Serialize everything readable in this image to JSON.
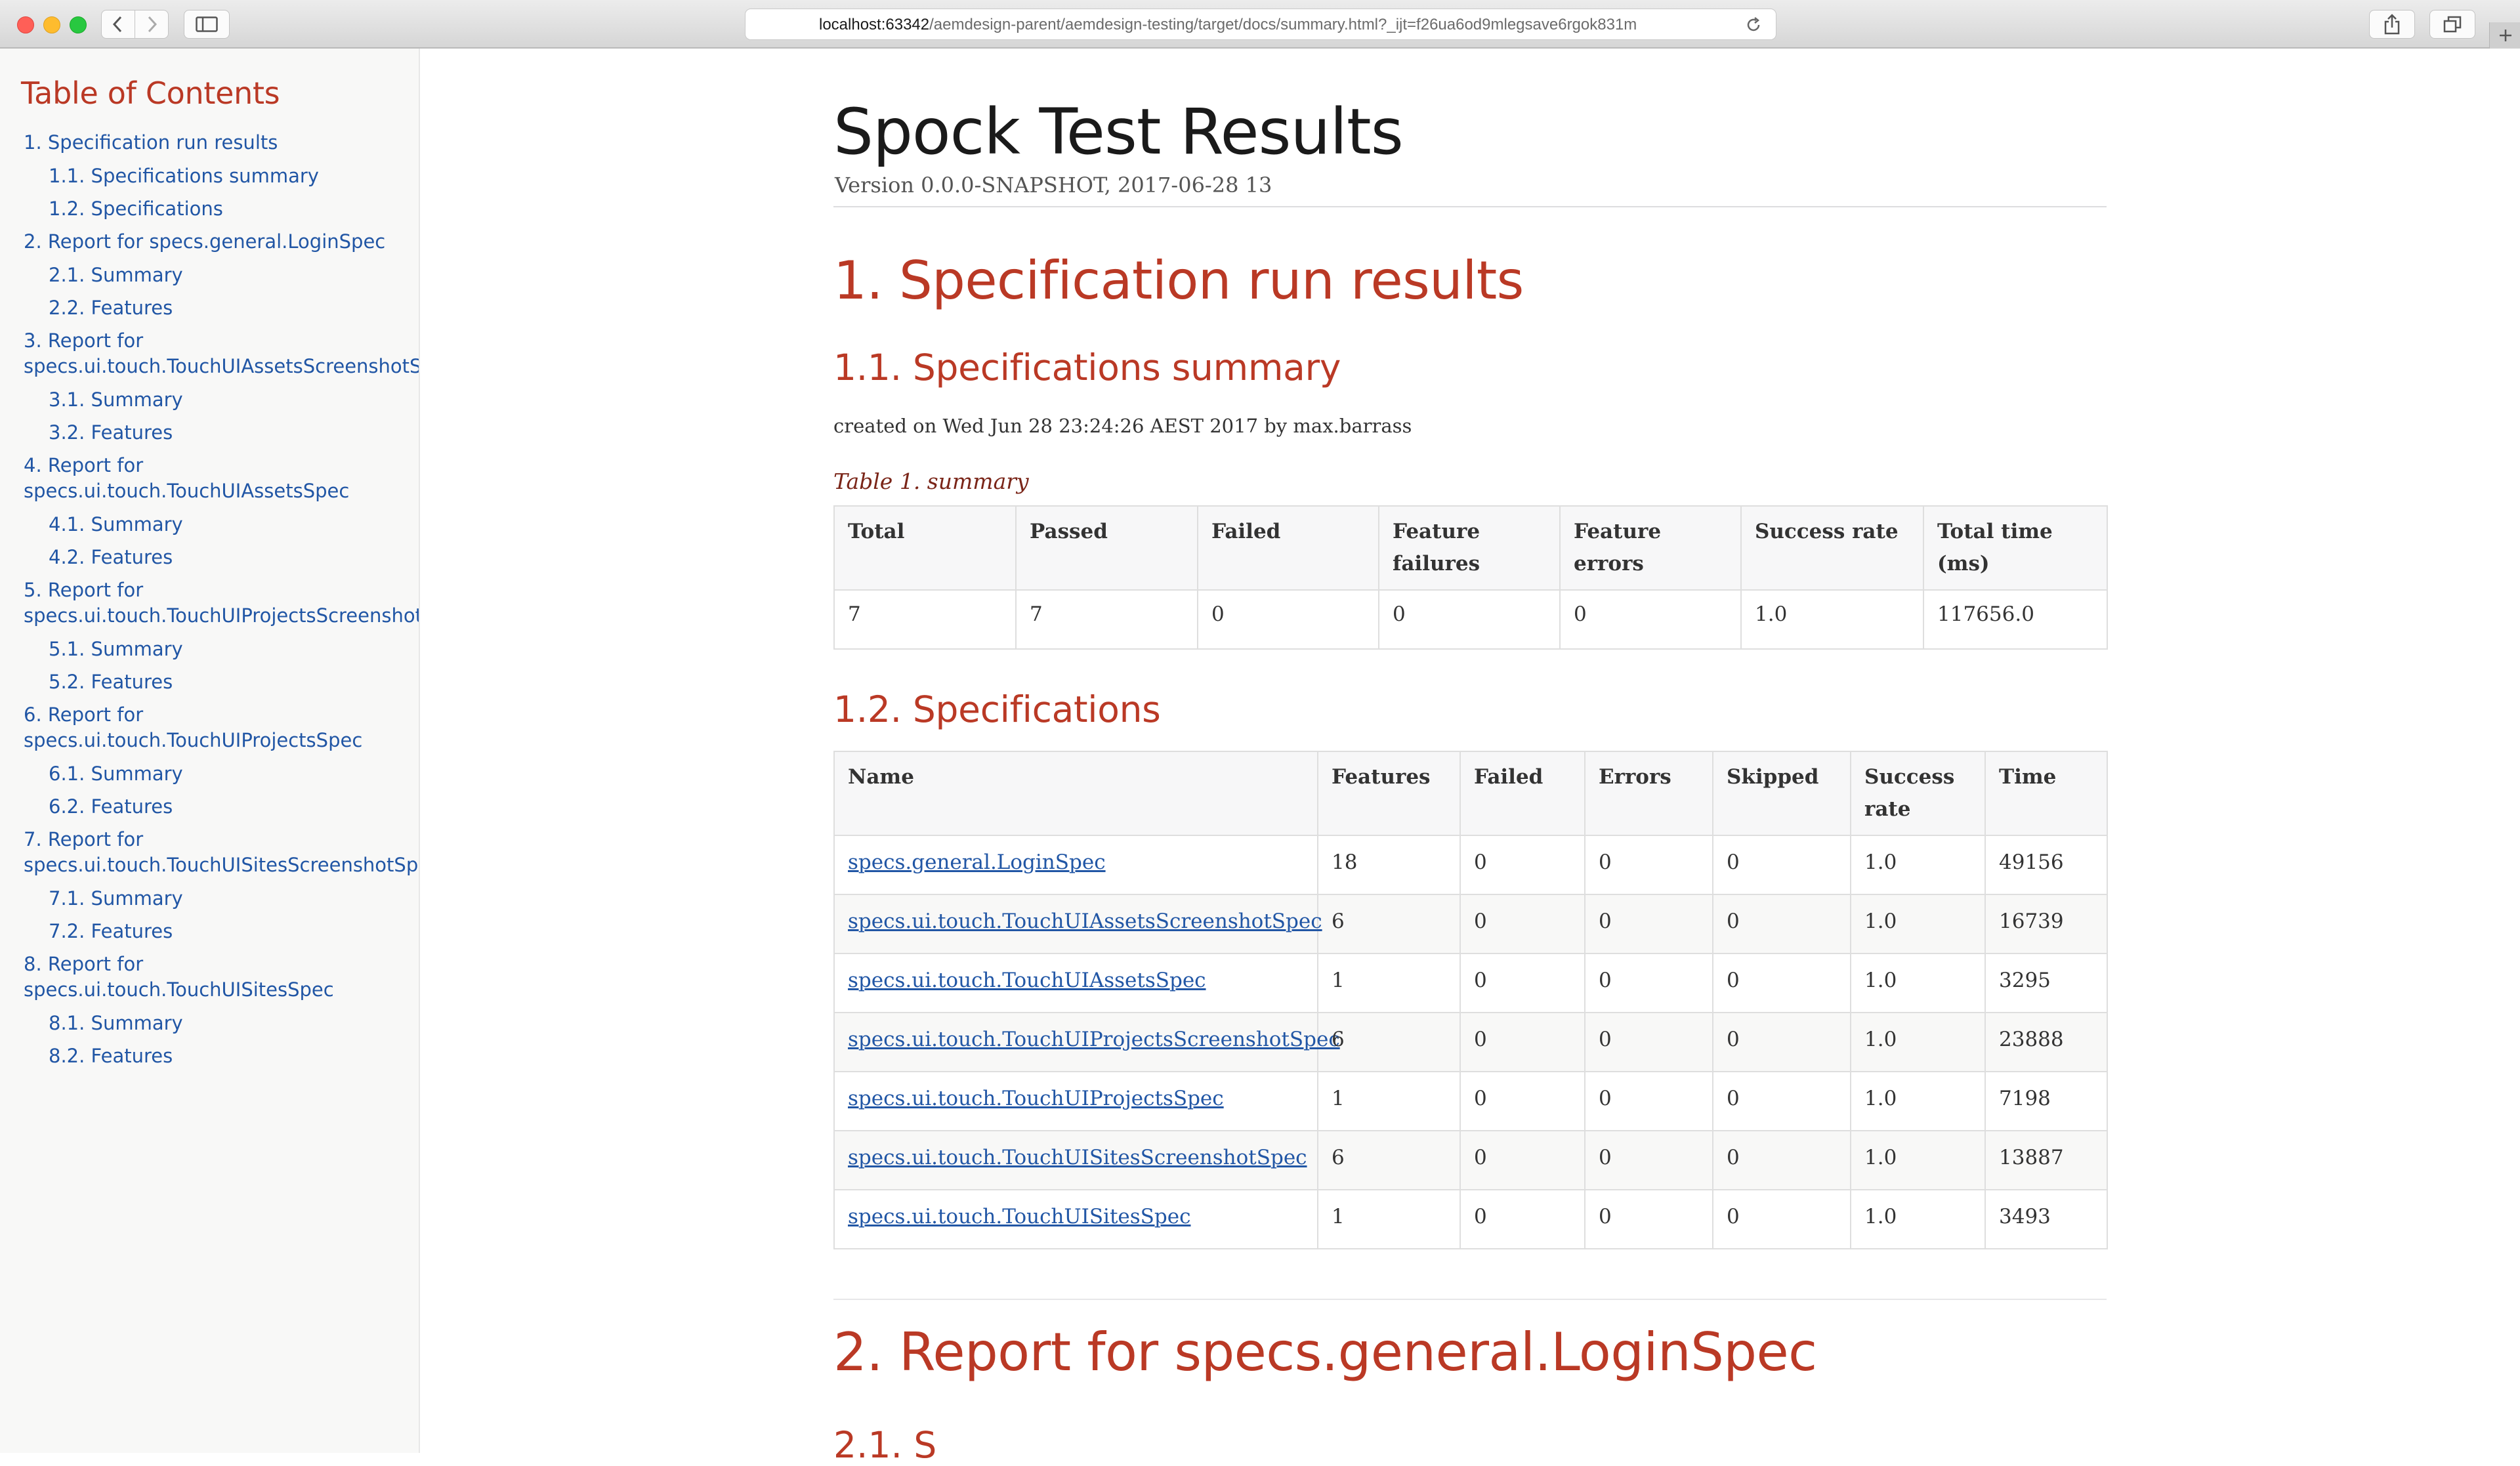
{
  "browser": {
    "url_host": "localhost:63342",
    "url_path": "/aemdesign-parent/aemdesign-testing/target/docs/summary.html?_ijt=f26ua6od9mlegsave6rgok831m"
  },
  "toc": {
    "title": "Table of Contents",
    "items": [
      {
        "label": "1. Specification run results",
        "children": [
          "1.1. Specifications summary",
          "1.2. Specifications"
        ]
      },
      {
        "label": "2. Report for specs.general.LoginSpec",
        "children": [
          "2.1. Summary",
          "2.2. Features"
        ]
      },
      {
        "label_a": "3. Report for",
        "label_b": "specs.ui.touch.TouchUIAssetsScreenshotSpec",
        "children": [
          "3.1. Summary",
          "3.2. Features"
        ]
      },
      {
        "label_a": "4. Report for",
        "label_b": "specs.ui.touch.TouchUIAssetsSpec",
        "children": [
          "4.1. Summary",
          "4.2. Features"
        ]
      },
      {
        "label_a": "5. Report for",
        "label_b": "specs.ui.touch.TouchUIProjectsScreenshotSpec",
        "children": [
          "5.1. Summary",
          "5.2. Features"
        ]
      },
      {
        "label_a": "6. Report for",
        "label_b": "specs.ui.touch.TouchUIProjectsSpec",
        "children": [
          "6.1. Summary",
          "6.2. Features"
        ]
      },
      {
        "label_a": "7. Report for",
        "label_b": "specs.ui.touch.TouchUISitesScreenshotSpec",
        "children": [
          "7.1. Summary",
          "7.2. Features"
        ]
      },
      {
        "label_a": "8. Report for",
        "label_b": "specs.ui.touch.TouchUISitesSpec",
        "children": [
          "8.1. Summary",
          "8.2. Features"
        ]
      }
    ]
  },
  "doc": {
    "title": "Spock Test Results",
    "version": "Version 0.0.0-SNAPSHOT, 2017-06-28 13"
  },
  "section1": {
    "heading": "1. Specification run results",
    "summary_heading": "1.1. Specifications summary",
    "created": "created on Wed Jun 28 23:24:26 AEST 2017 by max.barrass",
    "table_caption": "Table 1. summary",
    "summary_headers": [
      "Total",
      "Passed",
      "Failed",
      "Feature failures",
      "Feature errors",
      "Success rate",
      "Total time (ms)"
    ],
    "summary_row": [
      "7",
      "7",
      "0",
      "0",
      "0",
      "1.0",
      "117656.0"
    ],
    "specs_heading": "1.2. Specifications",
    "specs_headers": [
      "Name",
      "Features",
      "Failed",
      "Errors",
      "Skipped",
      "Success rate",
      "Time"
    ],
    "specs_rows": [
      [
        "specs.general.LoginSpec",
        "18",
        "0",
        "0",
        "0",
        "1.0",
        "49156"
      ],
      [
        "specs.ui.touch.TouchUIAssetsScreenshotSpec",
        "6",
        "0",
        "0",
        "0",
        "1.0",
        "16739"
      ],
      [
        "specs.ui.touch.TouchUIAssetsSpec",
        "1",
        "0",
        "0",
        "0",
        "1.0",
        "3295"
      ],
      [
        "specs.ui.touch.TouchUIProjectsScreenshotSpec",
        "6",
        "0",
        "0",
        "0",
        "1.0",
        "23888"
      ],
      [
        "specs.ui.touch.TouchUIProjectsSpec",
        "1",
        "0",
        "0",
        "0",
        "1.0",
        "7198"
      ],
      [
        "specs.ui.touch.TouchUISitesScreenshotSpec",
        "6",
        "0",
        "0",
        "0",
        "1.0",
        "13887"
      ],
      [
        "specs.ui.touch.TouchUISitesSpec",
        "1",
        "0",
        "0",
        "0",
        "1.0",
        "3493"
      ]
    ]
  },
  "section2": {
    "heading": "2. Report for specs.general.LoginSpec",
    "sub_heading_partial": "2.1. S"
  },
  "colors": {
    "heading_red": "#ba3925",
    "link_blue": "#2156a5",
    "caption_brown": "#7a2518"
  }
}
